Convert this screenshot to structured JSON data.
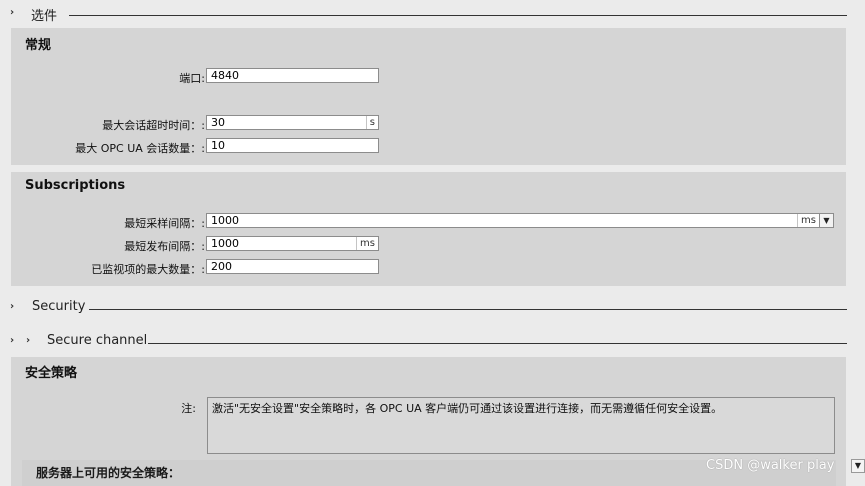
{
  "sections": {
    "options": {
      "title": "选件"
    },
    "security": {
      "title": "Security"
    },
    "secure_channel": {
      "title": "Secure channel"
    }
  },
  "general": {
    "title": "常规",
    "port": {
      "label": "端口:",
      "value": "4840"
    },
    "max_session_timeout": {
      "label": "最大会话超时时间：:",
      "value": "30",
      "unit": "s"
    },
    "max_sessions": {
      "label": "最大 OPC UA 会话数量：:",
      "value": "10"
    }
  },
  "subscriptions": {
    "title": "Subscriptions",
    "min_sampling": {
      "label": "最短采样间隔：:",
      "value": "1000",
      "unit": "ms"
    },
    "min_publishing": {
      "label": "最短发布间隔：:",
      "value": "1000",
      "unit": "ms"
    },
    "max_monitored": {
      "label": "已监视项的最大数量：:",
      "value": "200"
    }
  },
  "security_policy": {
    "title": "安全策略",
    "note_label": "注:",
    "note_text": "激活\"无安全设置\"安全策略时，各 OPC UA 客户端仍可通过该设置进行连接，而无需遵循任何安全设置。",
    "available_label": "服务器上可用的安全策略："
  },
  "watermark": "CSDN @walker play",
  "icons": {
    "chevron": "chevron-right-icon",
    "dropdown": "triangle-down-icon"
  }
}
